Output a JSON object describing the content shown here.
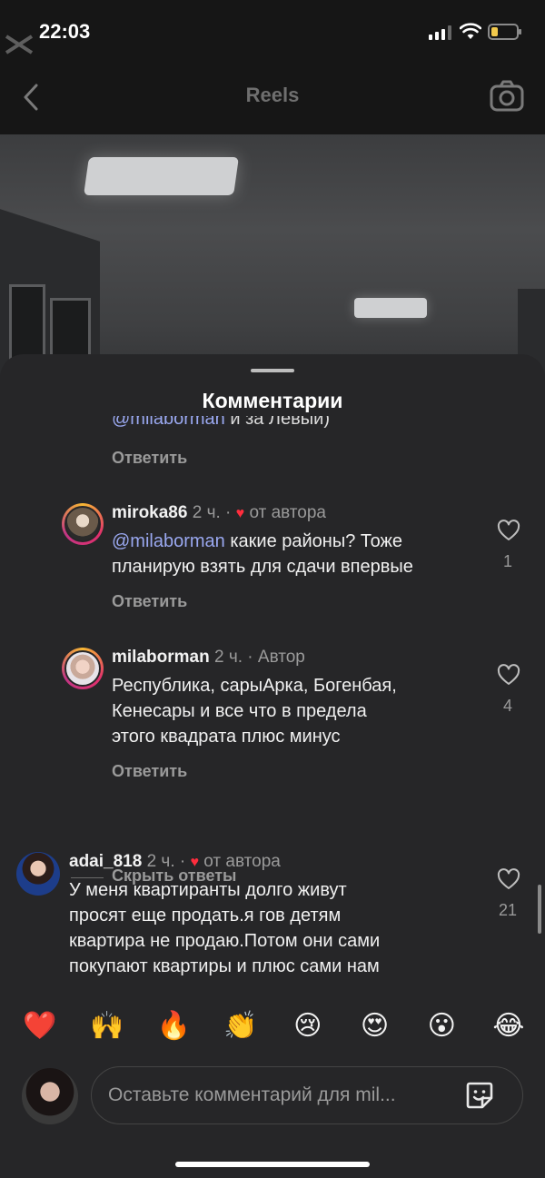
{
  "status_bar": {
    "time": "22:03"
  },
  "nav": {
    "title": "Reels"
  },
  "sheet": {
    "title": "Комментарии"
  },
  "comments": {
    "cut_off": {
      "mention": "@milaborman",
      "text": " и за Левый)"
    },
    "cut_off_reply": "Ответить",
    "items": [
      {
        "username": "miroka86",
        "time": "2 ч.",
        "tag": "от автора",
        "mention": "@milaborman",
        "line1": " какие районы? Тоже",
        "line2": "планирую взять для сдачи впервые",
        "likes": "1",
        "reply": "Ответить"
      },
      {
        "username": "milaborman",
        "time": "2 ч.",
        "tag": "Автор",
        "line1": "Республика, сарыАрка, Богенбая,",
        "line2": "Кенесары и все что в предела",
        "line3": "этого квадрата плюс минус",
        "likes": "4",
        "reply": "Ответить"
      },
      {
        "username": "adai_818",
        "time": "2 ч.",
        "tag": "от автора",
        "line1": "У меня квартиранты долго живут",
        "line2": "просят еще продать.я гов детям",
        "line3": "квартира не продаю.Потом они сами",
        "line4": "покупают квартиры и плюс сами нам",
        "likes": "21"
      }
    ],
    "hide_replies": "Скрыть ответы"
  },
  "reactions": [
    "❤️",
    "🙌",
    "🔥",
    "👏",
    "😢",
    "😍",
    "😮",
    "😂"
  ],
  "composer": {
    "placeholder": "Оставьте комментарий для mil..."
  },
  "colors": {
    "accent_mention": "#9aa8f0",
    "heart": "#ff2d3d",
    "sheet_bg": "#262628"
  }
}
